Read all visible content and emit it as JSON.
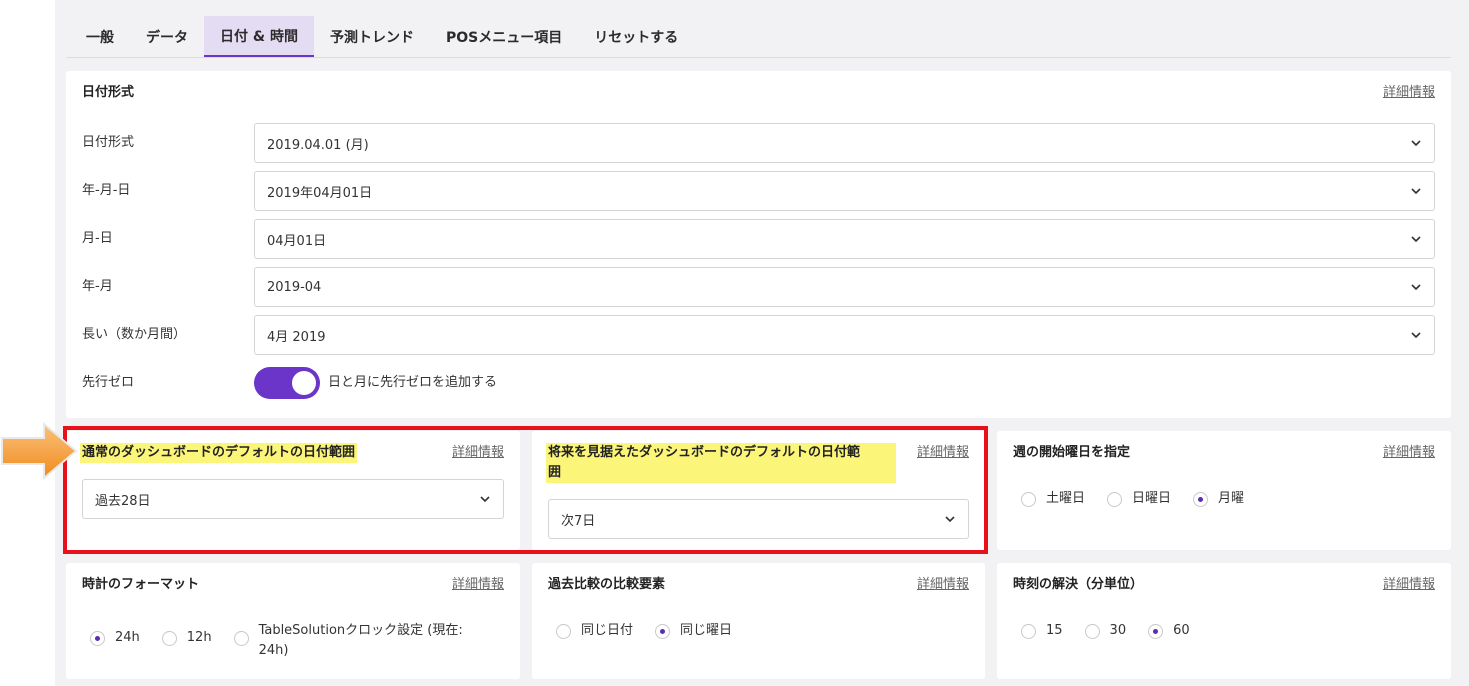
{
  "tabs": [
    {
      "label": "一般"
    },
    {
      "label": "データ"
    },
    {
      "label": "日付 & 時間",
      "active": true
    },
    {
      "label": "予測トレンド"
    },
    {
      "label": "POSメニュー項目"
    },
    {
      "label": "リセットする"
    }
  ],
  "date_format": {
    "title": "日付形式",
    "details_link": "詳細情報",
    "rows": [
      {
        "label": "日付形式",
        "value": "2019.04.01 (月)"
      },
      {
        "label": "年-月-日",
        "value": "2019年04月01日"
      },
      {
        "label": "月-日",
        "value": "04月01日"
      },
      {
        "label": "年-月",
        "value": "2019-04"
      },
      {
        "label": "長い（数か月間）",
        "value": "4月 2019"
      }
    ],
    "leading_zero": {
      "label": "先行ゼロ",
      "toggle_label": "日と月に先行ゼロを追加する",
      "enabled": true
    }
  },
  "default_range": {
    "title": "通常のダッシュボードのデフォルトの日付範囲",
    "details_link": "詳細情報",
    "value": "過去28日"
  },
  "future_range": {
    "title_line1": "将来を見据えたダッシュボードのデフォルトの日付範",
    "title_line2": "囲",
    "details_link": "詳細情報",
    "value": "次7日"
  },
  "week_start": {
    "title": "週の開始曜日を指定",
    "details_link": "詳細情報",
    "options": [
      "土曜日",
      "日曜日",
      "月曜"
    ],
    "selected": 2
  },
  "clock_format": {
    "title": "時計のフォーマット",
    "details_link": "詳細情報",
    "options": [
      "24h",
      "12h"
    ],
    "option3_line1": "TableSolutionクロック設定 (現在:",
    "option3_line2": "24h)",
    "selected": 0
  },
  "comparison": {
    "title": "過去比較の比較要素",
    "details_link": "詳細情報",
    "options": [
      "同じ日付",
      "同じ曜日"
    ],
    "selected": 1
  },
  "time_resolution": {
    "title": "時刻の解決（分単位）",
    "details_link": "詳細情報",
    "options": [
      "15",
      "30",
      "60"
    ],
    "selected": 2
  },
  "colors": {
    "accent": "#6a35c8",
    "highlight": "#fbf579",
    "annotation_red": "#e8111a",
    "arrow": "#f6a23a"
  }
}
